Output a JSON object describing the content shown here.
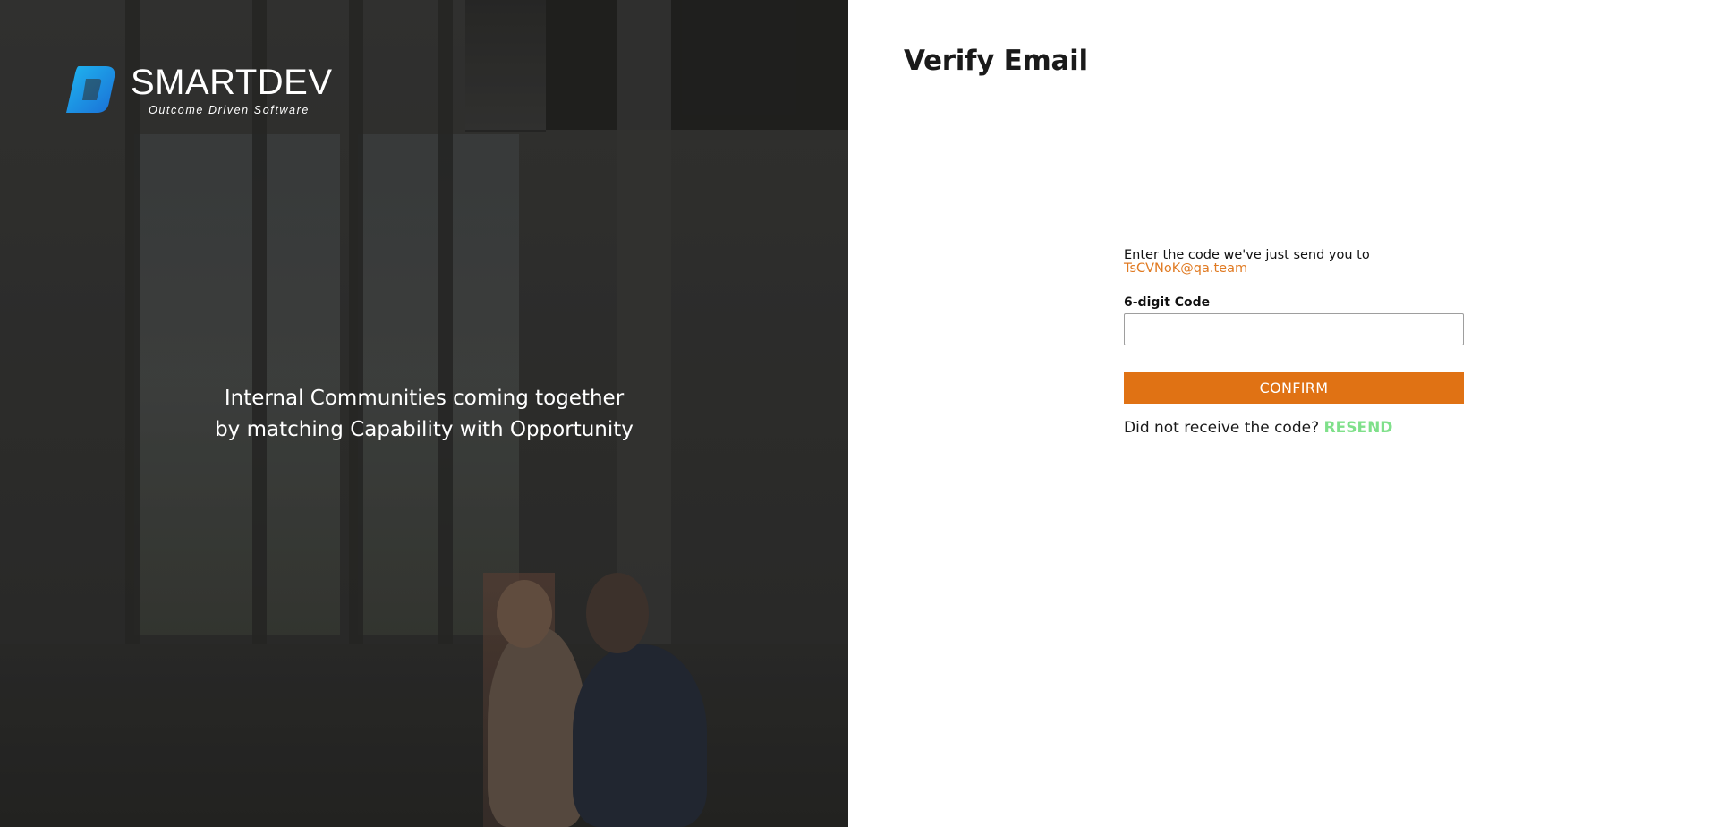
{
  "brand": {
    "name": "SMARTDEV",
    "tagline": "Outcome Driven Software",
    "logo_icon": "smartdev-logo-mark"
  },
  "hero": {
    "line1": "Internal Communities coming together",
    "line2": "by matching Capability with Opportunity"
  },
  "page": {
    "title": "Verify Email"
  },
  "form": {
    "instruction": "Enter the code we've just send you to",
    "email": "TsCVNoK@qa.team",
    "code_label": "6-digit Code",
    "code_value": "",
    "confirm_label": "CONFIRM",
    "resend_prompt": "Did not receive the code?",
    "resend_label": "RESEND"
  },
  "colors": {
    "accent": "#e07214",
    "email": "#e07a22",
    "resend": "#7fe08a",
    "logo_blue": "#1aa3e8"
  }
}
